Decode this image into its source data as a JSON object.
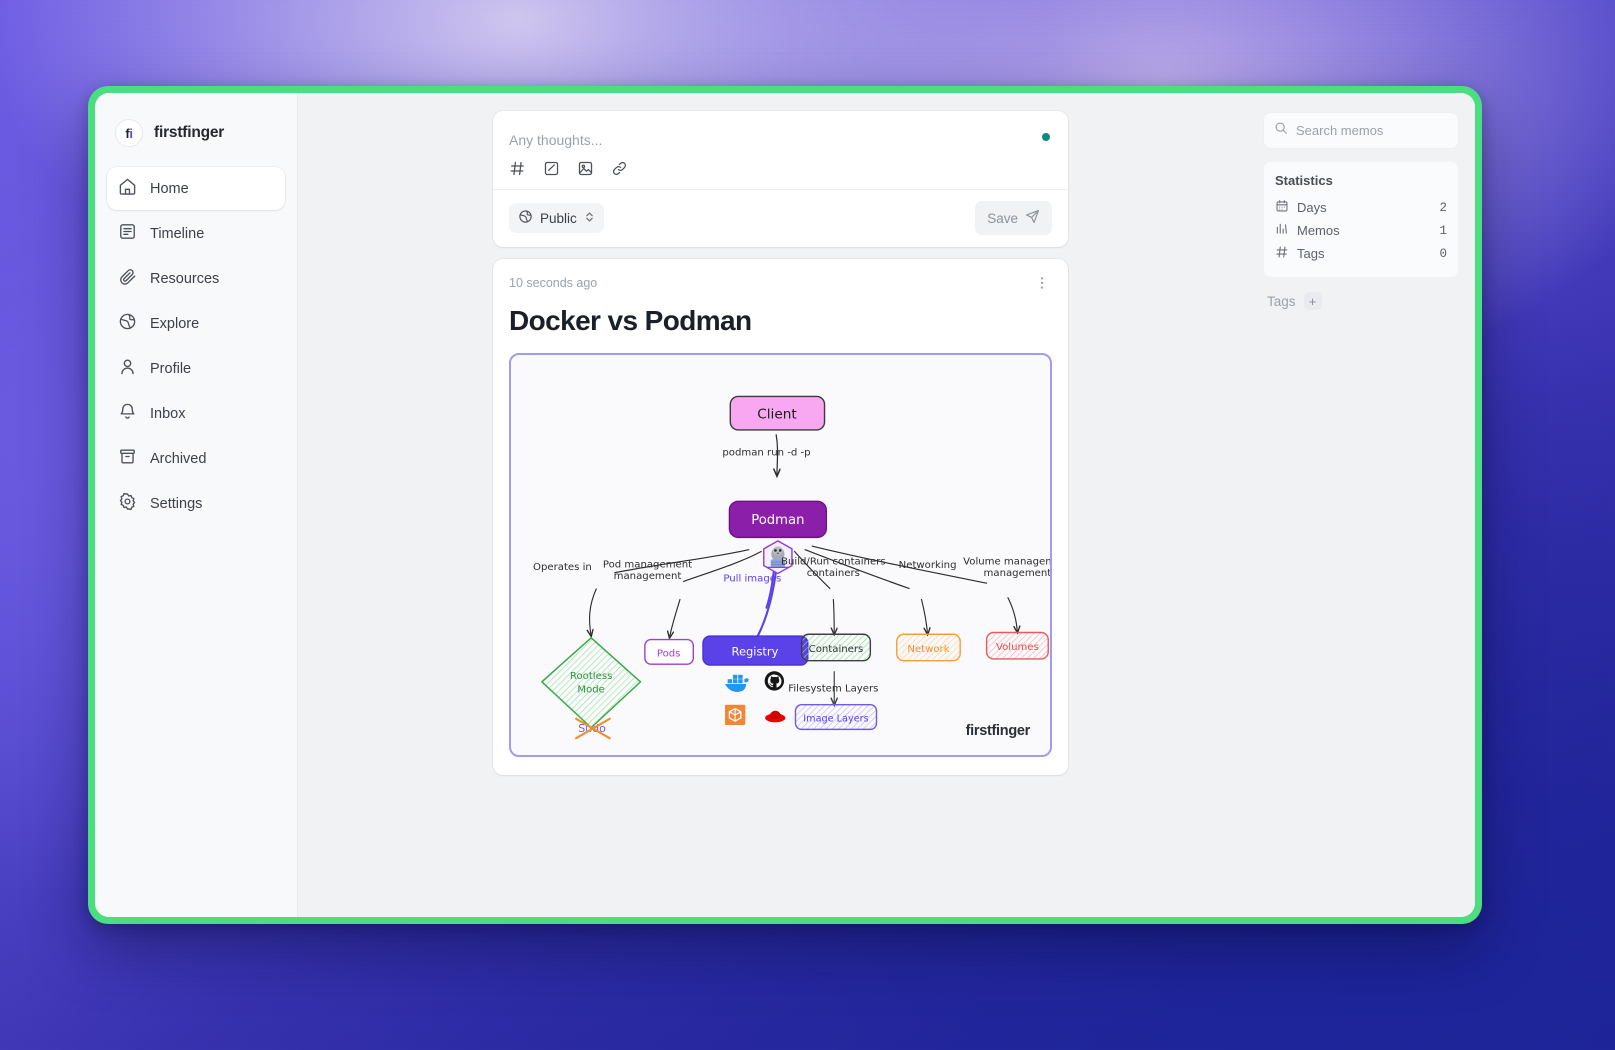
{
  "app": {
    "brand_initials": "fi",
    "brand_name": "firstfinger"
  },
  "sidebar": {
    "items": [
      {
        "label": "Home",
        "icon": "home-icon",
        "active": true
      },
      {
        "label": "Timeline",
        "icon": "timeline-icon",
        "active": false
      },
      {
        "label": "Resources",
        "icon": "paperclip-icon",
        "active": false
      },
      {
        "label": "Explore",
        "icon": "globe-icon",
        "active": false
      },
      {
        "label": "Profile",
        "icon": "user-icon",
        "active": false
      },
      {
        "label": "Inbox",
        "icon": "bell-icon",
        "active": false
      },
      {
        "label": "Archived",
        "icon": "archive-icon",
        "active": false
      },
      {
        "label": "Settings",
        "icon": "gear-icon",
        "active": false
      }
    ]
  },
  "editor": {
    "placeholder": "Any thoughts...",
    "tools": [
      {
        "name": "hash-icon",
        "glyph": "#"
      },
      {
        "name": "checkbox-icon",
        "glyph": "☑"
      },
      {
        "name": "image-icon",
        "glyph": "🖼"
      },
      {
        "name": "link-icon",
        "glyph": "🔗"
      }
    ],
    "visibility_label": "Public",
    "save_label": "Save",
    "status_dot_color": "#10897c"
  },
  "memo": {
    "timestamp": "10 seconds ago",
    "title": "Docker vs Podman",
    "watermark": "firstfinger"
  },
  "diagram": {
    "type": "flowchart",
    "style": "hand-drawn",
    "nodes": [
      {
        "id": "client",
        "label": "Client",
        "shape": "rounded-rect",
        "fill": "#f8a8f0",
        "stroke": "#3b3b3b",
        "text": "#1b1b1b"
      },
      {
        "id": "podman",
        "label": "Podman",
        "shape": "rounded-rect",
        "fill": "#8b1fa9",
        "stroke": "#6d1285",
        "text": "#ffffff"
      },
      {
        "id": "rootless",
        "label": "Rootless Mode",
        "shape": "diamond",
        "fill": "#d9f7d9",
        "stroke": "#3aa84a",
        "text": "#2f9140"
      },
      {
        "id": "pods",
        "label": "Pods",
        "shape": "rounded-rect",
        "fill": "#ffffff",
        "stroke": "#a040c8",
        "text": "#a040c8"
      },
      {
        "id": "registry",
        "label": "Registry",
        "shape": "rounded-rect",
        "fill": "#5b41e8",
        "stroke": "#4a33cf",
        "text": "#ffffff"
      },
      {
        "id": "containers",
        "label": "Containers",
        "shape": "rounded-rect",
        "fill": "#d7f5d9",
        "stroke": "#3c4044",
        "text": "#2f3438"
      },
      {
        "id": "network",
        "label": "Network",
        "shape": "rounded-rect",
        "fill": "#fdf0da",
        "stroke": "#f29f3d",
        "text": "#f0922a"
      },
      {
        "id": "volumes",
        "label": "Volumes",
        "shape": "rounded-rect",
        "fill": "#fde8e8",
        "stroke": "#e85b5b",
        "text": "#e04f4f"
      },
      {
        "id": "imglayers",
        "label": "Image Layers",
        "shape": "rounded-rect",
        "fill": "#eeeafd",
        "stroke": "#6f5ae8",
        "text": "#5b41e8"
      },
      {
        "id": "sudo",
        "label": "Sudo",
        "shape": "crossed-text",
        "fill": "none",
        "stroke": "#f0922a",
        "text": "#6f5ae8"
      }
    ],
    "edges": [
      {
        "from": "client",
        "to": "podman",
        "label": "podman run -d -p",
        "color": "#2e2e2e"
      },
      {
        "from": "podman",
        "to": "rootless",
        "label": "Operates in",
        "color": "#2e2e2e"
      },
      {
        "from": "podman",
        "to": "pods",
        "label": "Pod management",
        "color": "#2e2e2e"
      },
      {
        "from": "podman",
        "to": "registry",
        "label": "Pull images",
        "color": "#5b41e8"
      },
      {
        "from": "podman",
        "to": "containers",
        "label": "Build/Run containers",
        "color": "#2e2e2e"
      },
      {
        "from": "podman",
        "to": "network",
        "label": "Networking",
        "color": "#2e2e2e"
      },
      {
        "from": "podman",
        "to": "volumes",
        "label": "Volume management",
        "color": "#2e2e2e"
      },
      {
        "from": "containers",
        "to": "imglayers",
        "label": "Filesystem Layers",
        "color": "#3c4044"
      }
    ],
    "registry_logos": [
      "docker-icon",
      "github-icon",
      "ecr-icon",
      "redhat-icon"
    ],
    "center_logo": "podman-seal-icon"
  },
  "search": {
    "placeholder": "Search memos",
    "value": ""
  },
  "statistics": {
    "title": "Statistics",
    "rows": [
      {
        "icon": "calendar-icon",
        "label": "Days",
        "value": "2"
      },
      {
        "icon": "chart-icon",
        "label": "Memos",
        "value": "1"
      },
      {
        "icon": "hash-icon",
        "label": "Tags",
        "value": "0"
      }
    ]
  },
  "tags": {
    "label": "Tags",
    "add_glyph": "+"
  },
  "theme": {
    "frame_green": "#4ade80",
    "accent_purple": "#5b41e8",
    "bg_purple": "#5b4fd6",
    "bg_deep_blue": "#221f8f"
  }
}
